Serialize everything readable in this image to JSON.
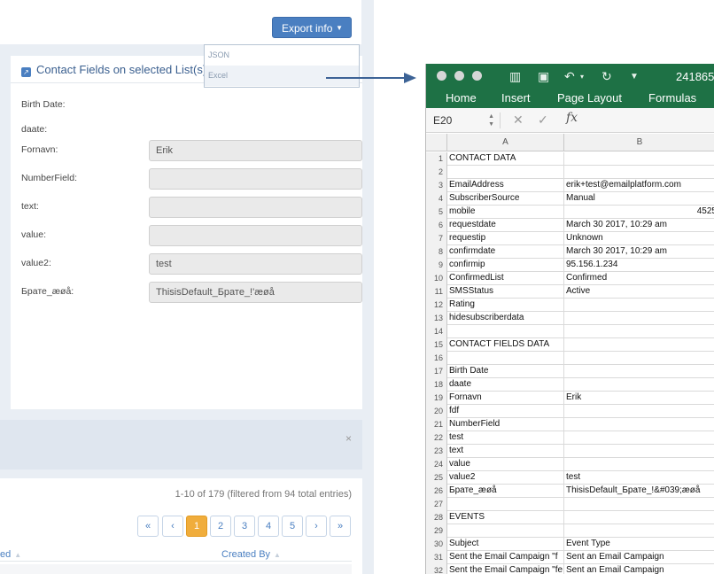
{
  "left_app": {
    "export_button": {
      "label": "Export info"
    },
    "export_menu": [
      {
        "label": "JSON"
      },
      {
        "label": "Excel"
      }
    ],
    "panel": {
      "title": "Contact Fields on selected List(s)",
      "fields": [
        {
          "label": "Birth Date:",
          "value": null
        },
        {
          "label": "daate:",
          "value": null
        },
        {
          "label": "Fornavn:",
          "value": "Erik"
        },
        {
          "label": "NumberField:",
          "value": ""
        },
        {
          "label": "text:",
          "value": ""
        },
        {
          "label": "value:",
          "value": ""
        },
        {
          "label": "value2:",
          "value": "test"
        },
        {
          "label": "Брате_æøå:",
          "value": "ThisisDefault_Брате_!'æøå"
        }
      ]
    },
    "alert": {
      "close_glyph": "×"
    },
    "table": {
      "info": "1-10 of 179 (filtered from 94 total entries)",
      "pagination": [
        "«",
        "‹",
        "1",
        "2",
        "3",
        "4",
        "5",
        "›",
        "»"
      ],
      "active_page": "1",
      "columns": [
        {
          "label": "ed",
          "sort": "▲"
        },
        {
          "label": "Created By",
          "sort": "▲"
        }
      ]
    }
  },
  "excel": {
    "title": "241865",
    "ribbon_tabs": [
      "Home",
      "Insert",
      "Page Layout",
      "Formulas"
    ],
    "name_box": "E20",
    "fx_symbol": "fx",
    "columns": [
      "A",
      "B"
    ],
    "rows": [
      {
        "n": "1",
        "a": "CONTACT DATA",
        "b": ""
      },
      {
        "n": "2",
        "a": "",
        "b": ""
      },
      {
        "n": "3",
        "a": "EmailAddress",
        "b": "erik+test@emailplatform.com"
      },
      {
        "n": "4",
        "a": "SubscriberSource",
        "b": "Manual"
      },
      {
        "n": "5",
        "a": "mobile",
        "b": "4525"
      },
      {
        "n": "6",
        "a": "requestdate",
        "b": "March 30 2017, 10:29 am"
      },
      {
        "n": "7",
        "a": "requestip",
        "b": "Unknown"
      },
      {
        "n": "8",
        "a": "confirmdate",
        "b": "March 30 2017, 10:29 am"
      },
      {
        "n": "9",
        "a": "confirmip",
        "b": "95.156.1.234"
      },
      {
        "n": "10",
        "a": "ConfirmedList",
        "b": "Confirmed"
      },
      {
        "n": "11",
        "a": "SMSStatus",
        "b": "Active"
      },
      {
        "n": "12",
        "a": "Rating",
        "b": ""
      },
      {
        "n": "13",
        "a": "hidesubscriberdata",
        "b": ""
      },
      {
        "n": "14",
        "a": "",
        "b": ""
      },
      {
        "n": "15",
        "a": "CONTACT FIELDS DATA",
        "b": ""
      },
      {
        "n": "16",
        "a": "",
        "b": ""
      },
      {
        "n": "17",
        "a": "Birth Date",
        "b": ""
      },
      {
        "n": "18",
        "a": "daate",
        "b": ""
      },
      {
        "n": "19",
        "a": "Fornavn",
        "b": "Erik"
      },
      {
        "n": "20",
        "a": "fdf",
        "b": ""
      },
      {
        "n": "21",
        "a": "NumberField",
        "b": ""
      },
      {
        "n": "22",
        "a": "test",
        "b": ""
      },
      {
        "n": "23",
        "a": "text",
        "b": ""
      },
      {
        "n": "24",
        "a": "value",
        "b": ""
      },
      {
        "n": "25",
        "a": "value2",
        "b": "test"
      },
      {
        "n": "26",
        "a": "Брате_æøå",
        "b": "ThisisDefault_Брате_!&#039;æøå"
      },
      {
        "n": "27",
        "a": "",
        "b": ""
      },
      {
        "n": "28",
        "a": "EVENTS",
        "b": ""
      },
      {
        "n": "29",
        "a": "",
        "b": ""
      },
      {
        "n": "30",
        "a": "Subject",
        "b": "Event Type"
      },
      {
        "n": "31",
        "a": "Sent the Email Campaign \"f",
        "b": "Sent an Email Campaign"
      },
      {
        "n": "32",
        "a": "Sent the Email Campaign \"fe",
        "b": "Sent an Email Campaign"
      }
    ]
  }
}
